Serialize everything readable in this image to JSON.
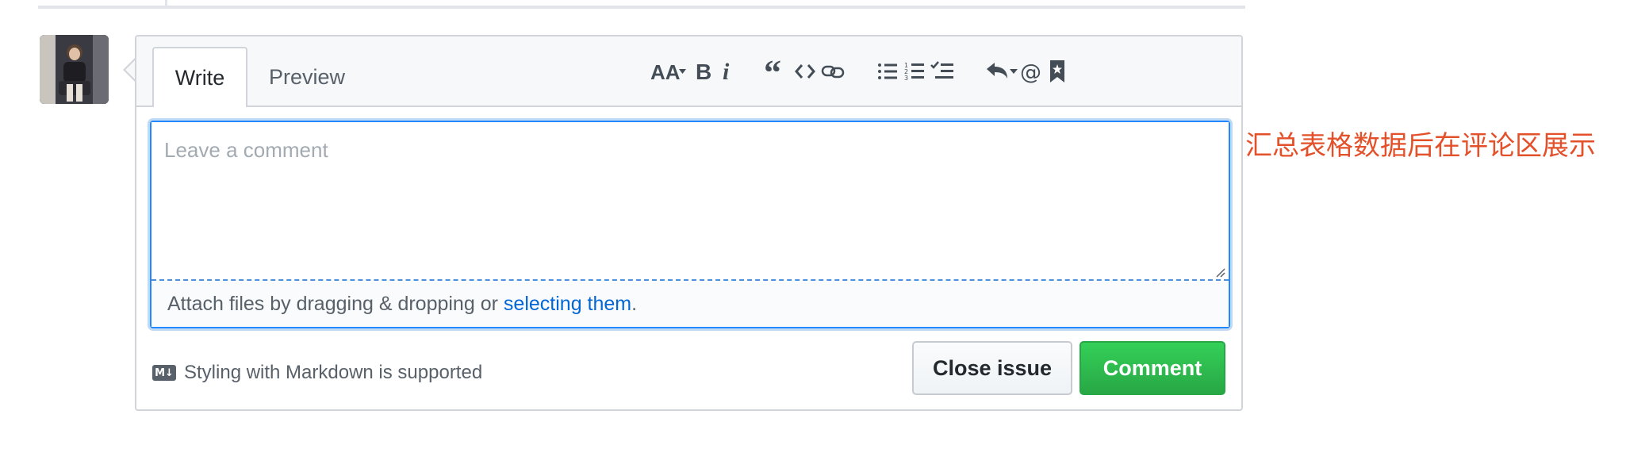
{
  "tabs": {
    "write": "Write",
    "preview": "Preview"
  },
  "toolbar": [
    {
      "name": "header-text-icon",
      "label": "AA"
    },
    {
      "name": "bold-icon",
      "label": "B"
    },
    {
      "name": "italic-icon",
      "label": "i"
    },
    {
      "name": "quote-icon"
    },
    {
      "name": "code-icon"
    },
    {
      "name": "link-icon"
    },
    {
      "name": "unordered-list-icon"
    },
    {
      "name": "ordered-list-icon"
    },
    {
      "name": "task-list-icon"
    },
    {
      "name": "reply-icon"
    },
    {
      "name": "mention-icon",
      "label": "@"
    },
    {
      "name": "bookmark-icon"
    }
  ],
  "editor": {
    "placeholder": "Leave a comment",
    "attach_text": "Attach files by dragging & dropping or",
    "attach_link": "selecting them",
    "attach_end": "."
  },
  "footer": {
    "markdown_text": "Styling with Markdown is supported",
    "close_label": "Close issue",
    "comment_label": "Comment"
  },
  "annotation": "汇总表格数据后在评论区展示",
  "colors": {
    "accent": "#2188ff",
    "link": "#0366d6",
    "success": "#28a745",
    "annotation": "#e3512b"
  }
}
